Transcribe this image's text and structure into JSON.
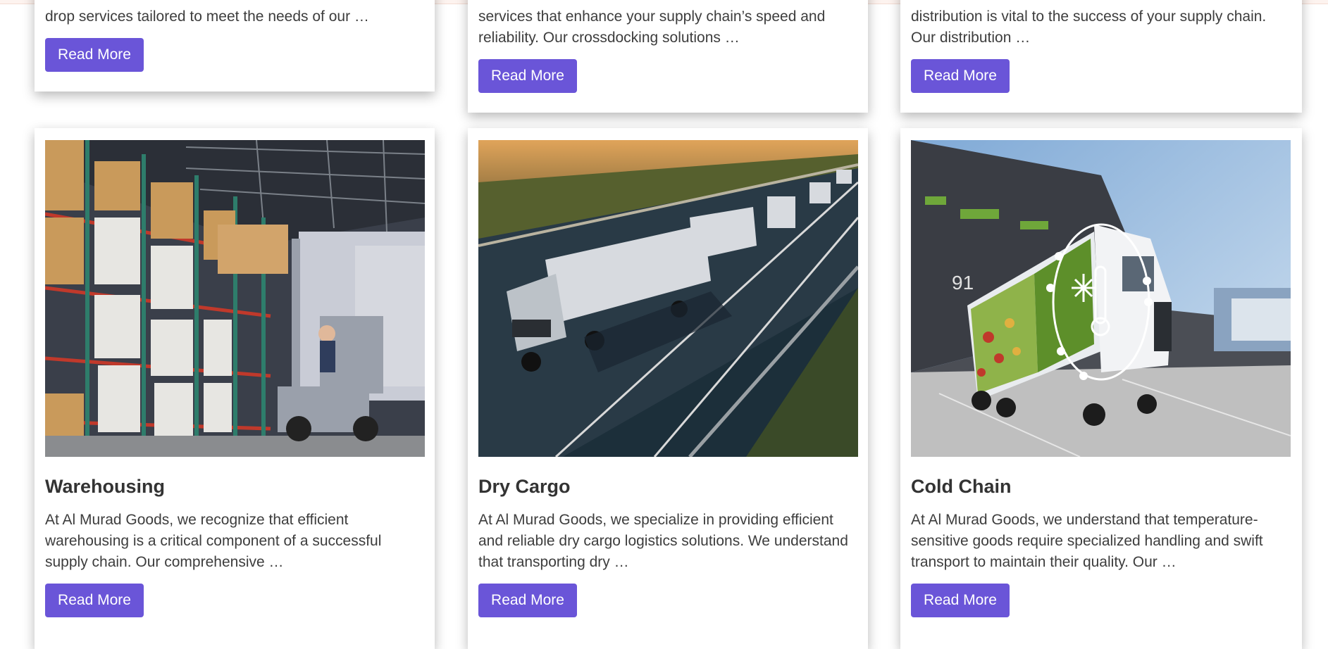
{
  "theme": {
    "accent": "#6a55d8"
  },
  "top_cards": [
    {
      "excerpt": "drop services tailored to meet the needs of our …",
      "button": "Read More"
    },
    {
      "excerpt": "services that enhance your supply chain’s speed and\nreliability. Our crossdocking solutions …",
      "button": "Read More"
    },
    {
      "excerpt": "distribution is vital to the success of your supply chain.\nOur distribution …",
      "button": "Read More"
    }
  ],
  "cards": [
    {
      "title": "Warehousing",
      "excerpt": "At Al Murad Goods, we recognize that efficient\nwarehousing is a critical component of a successful\nsupply chain. Our comprehensive …",
      "button": "Read More",
      "image": "warehouse-forklift-image"
    },
    {
      "title": "Dry Cargo",
      "excerpt": "At Al Murad Goods, we specialize in providing efficient\nand reliable dry cargo logistics solutions. We understand\nthat transporting dry …",
      "button": "Read More",
      "image": "highway-trucks-image"
    },
    {
      "title": "Cold Chain",
      "excerpt": "At Al Murad Goods, we understand that temperature-\nsensitive goods require specialized handling and swift\ntransport to maintain their quality. Our …",
      "button": "Read More",
      "image": "refrigerated-truck-image",
      "image_text": "91"
    }
  ]
}
